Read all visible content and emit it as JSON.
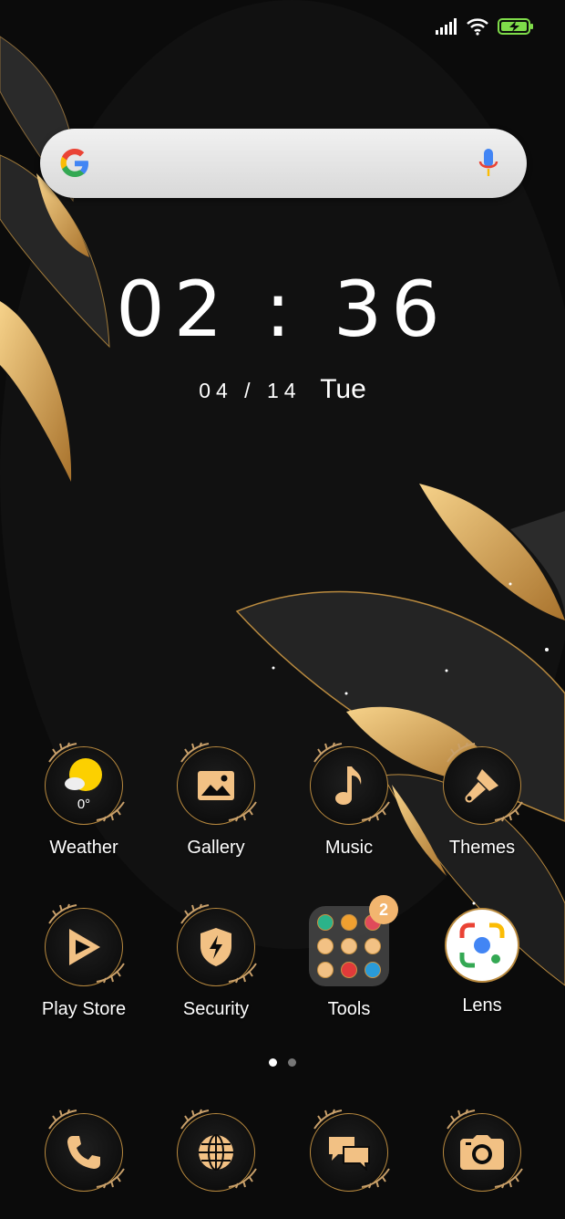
{
  "status_bar": {
    "icons": [
      "signal-icon",
      "wifi-icon",
      "battery-charging-icon"
    ]
  },
  "search": {
    "logo": "google-logo",
    "mic": "mic-icon"
  },
  "clock": {
    "time": "02 : 36",
    "date": "04 / 14",
    "weekday": "Tue"
  },
  "apps_row1": [
    {
      "label": "Weather",
      "icon": "weather-icon",
      "temp": "0°"
    },
    {
      "label": "Gallery",
      "icon": "gallery-icon"
    },
    {
      "label": "Music",
      "icon": "music-icon"
    },
    {
      "label": "Themes",
      "icon": "brush-icon"
    }
  ],
  "apps_row2": [
    {
      "label": "Play Store",
      "icon": "play-store-icon"
    },
    {
      "label": "Security",
      "icon": "security-icon"
    },
    {
      "label": "Tools",
      "icon": "folder-icon",
      "badge": "2"
    },
    {
      "label": "Lens",
      "icon": "lens-icon"
    }
  ],
  "page_indicator": {
    "pages": 2,
    "current": 1
  },
  "dock": [
    {
      "icon": "phone-icon"
    },
    {
      "icon": "browser-icon"
    },
    {
      "icon": "messages-icon"
    },
    {
      "icon": "camera-icon"
    }
  ],
  "colors": {
    "gold": "#f2c184",
    "accent_ring": "#b98a3f",
    "background": "#0b0b0b"
  }
}
